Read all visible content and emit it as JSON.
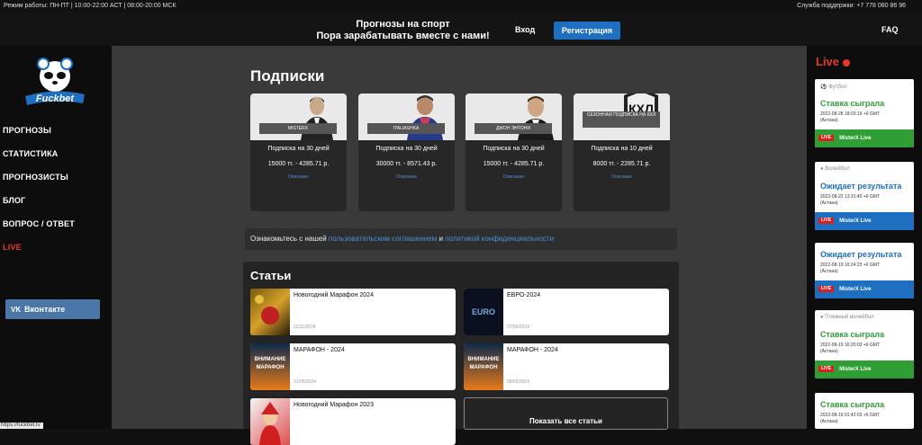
{
  "topbar": {
    "hours": "Режим работы: ПН-ПТ | 10:00-22:00 АСТ | 08:00-20:00 МСК",
    "support": "Служба поддержки: +7 778 080 86 96"
  },
  "header": {
    "promo_line1": "Прогнозы на спорт",
    "promo_line2": "Пора зарабатывать вместе с нами!",
    "login": "Вход",
    "register": "Регистрация",
    "faq": "FAQ"
  },
  "sidebar": {
    "logo_text": "Fuckbet",
    "items": [
      {
        "label": "ПРОГНОЗЫ"
      },
      {
        "label": "СТАТИСТИКА"
      },
      {
        "label": "ПРОГНОЗИСТЫ"
      },
      {
        "label": "БЛОГ"
      },
      {
        "label": "ВОПРОС / ОТВЕТ"
      },
      {
        "label": "LIVE"
      }
    ],
    "vk": "Вконтакте",
    "status_url": "https://fuckbet.tv"
  },
  "subscriptions": {
    "title": "Подписки",
    "cards": [
      {
        "tag": "MISTERX",
        "name": "Подписка на 30 дней",
        "price": "15000 тг. - 4285.71 р.",
        "link": "Описание"
      },
      {
        "tag": "ITALIASHKA",
        "name": "Подписка на 30 дней",
        "price": "30000 тг. - 8571.43 р.",
        "link": "Описание"
      },
      {
        "tag": "ДЖОН ЭНТОНИ",
        "name": "Подписка на 30 дней",
        "price": "15000 тг. - 4285.71 р.",
        "link": "Описание"
      },
      {
        "tag": "СЕЗОННАЯ ПОДПИСКА НА КХЛ",
        "name": "Подписка на 10 дней",
        "price": "8000 тг. - 2285.71 р.",
        "link": "Описание",
        "logo": "КХЛ"
      }
    ]
  },
  "agreement": {
    "prefix": "Ознакомьтесь с нашей",
    "link1": "пользовательским соглашением",
    "and": "и",
    "link2": "политикой конфиденциальности"
  },
  "articles": {
    "title": "Статьи",
    "items": [
      {
        "title": "Новогодний Марафон 2024",
        "date": "22/11/2024",
        "thumb_text": ""
      },
      {
        "title": "ЕВРО-2024",
        "date": "07/06/2024",
        "thumb_text": "EURO"
      },
      {
        "title": "МАРАФОН - 2024",
        "date": "31/05/2024",
        "thumb_text": "ВНИМАНИЕ МАРАФОН"
      },
      {
        "title": "МАРАФОН - 2024",
        "date": "08/05/2024",
        "thumb_text": "ВНИМАНИЕ МАРАФОН"
      },
      {
        "title": "Новогодний Марафон 2023",
        "date": "",
        "thumb_text": ""
      }
    ],
    "show_all": "Показать все статьи"
  },
  "live": {
    "title": "Live",
    "events": [
      {
        "sport": "Футбол",
        "status": "Ставка сыграла",
        "datetime": "2022-08-28 18:03:19 +6 GMT",
        "city": "(Астана)",
        "badge": "LIVE",
        "team": "MisterX Live",
        "color": "green"
      },
      {
        "sport": "Волейбол",
        "status": "Ожидает результата",
        "datetime": "2022-08-22 13:31:40 +6 GMT",
        "city": "(Астана)",
        "badge": "LIVE",
        "team": "MisterX Live",
        "color": "blue"
      },
      {
        "sport": "",
        "status": "Ожидает результата",
        "datetime": "2022-08-19 16:24:23 +6 GMT",
        "city": "(Астана)",
        "badge": "LIVE",
        "team": "MisterX Live",
        "color": "blue"
      },
      {
        "sport": "Пляжный волейбол",
        "status": "Ставка сыграла",
        "datetime": "2022-08-19 16:20:03 +6 GMT",
        "city": "(Астана)",
        "badge": "LIVE",
        "team": "MisterX Live",
        "color": "green"
      },
      {
        "sport": "",
        "status": "Ставка сыграла",
        "datetime": "2022-08-19 01:42:03 +6 GMT",
        "city": "(Астана)",
        "badge": "",
        "team": "",
        "color": "green"
      }
    ]
  },
  "colors": {
    "accent_blue": "#1e6fc0",
    "live_red": "#e53a2a",
    "win_green": "#2e9e35"
  }
}
